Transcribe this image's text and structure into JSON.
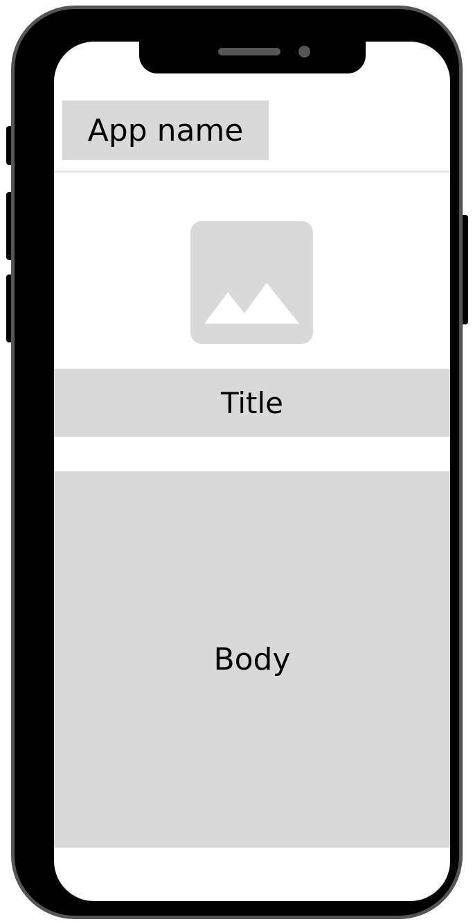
{
  "app": {
    "name": "App name"
  },
  "main": {
    "image_icon": "image-placeholder-icon",
    "title": "Title",
    "body": "Body"
  },
  "colors": {
    "placeholder_fill": "#d9d9d9",
    "frame": "#000000",
    "frame_border": "#555555",
    "screen": "#ffffff"
  }
}
